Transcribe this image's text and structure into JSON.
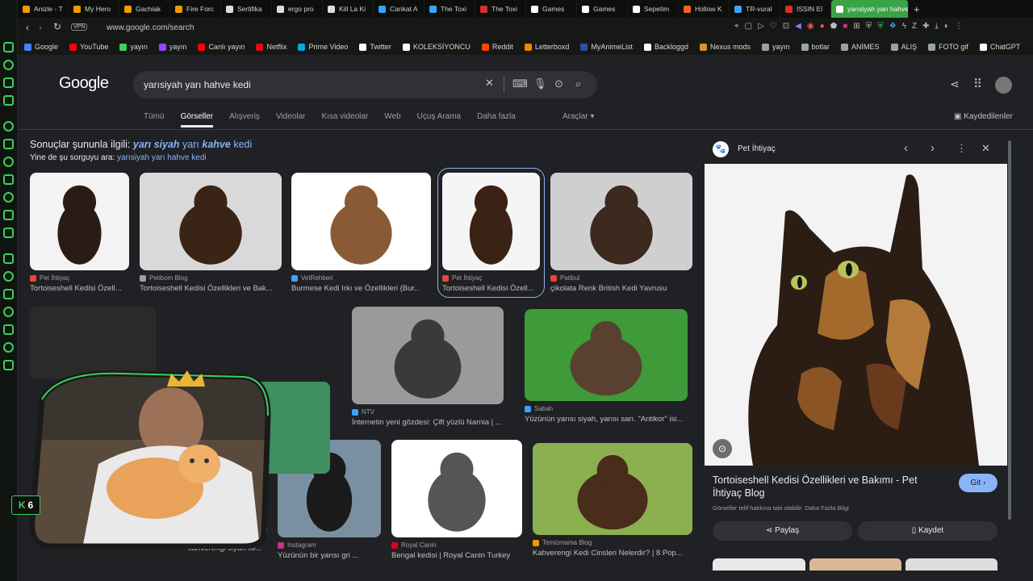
{
  "browser": {
    "tabs": [
      {
        "label": "Anizle - T",
        "color": "#f29900"
      },
      {
        "label": "My Hero",
        "color": "#f29900"
      },
      {
        "label": "Gachiak",
        "color": "#f29900"
      },
      {
        "label": "Fire Forc",
        "color": "#f29900"
      },
      {
        "label": "Sertifika",
        "color": "#dddddd"
      },
      {
        "label": "ergo pro",
        "color": "#dddddd"
      },
      {
        "label": "Kill La Ki",
        "color": "#dddddd"
      },
      {
        "label": "Cankat A",
        "color": "#3aa3ff"
      },
      {
        "label": "The Toxi",
        "color": "#3aa3ff"
      },
      {
        "label": "The Toxi",
        "color": "#d93025"
      },
      {
        "label": "Games",
        "color": "#ffffff"
      },
      {
        "label": "Games",
        "color": "#ffffff"
      },
      {
        "label": "Sepetim",
        "color": "#ffffff"
      },
      {
        "label": "Hollow K",
        "color": "#f26522"
      },
      {
        "label": "TR-vural",
        "color": "#3aa3ff"
      },
      {
        "label": "ISSIN El",
        "color": "#d93025"
      },
      {
        "label": "yarısiyah yarı hahve",
        "color": "#ffffff"
      }
    ],
    "url": "www.google.com/search",
    "vpn_label": "VPN",
    "bookmarks": [
      {
        "label": "Google",
        "color": "#4285f4"
      },
      {
        "label": "YouTube",
        "color": "#ff0000"
      },
      {
        "label": "yayın",
        "color": "#3ad15a"
      },
      {
        "label": "yayın",
        "color": "#9146ff"
      },
      {
        "label": "Canlı yayın",
        "color": "#ff0000"
      },
      {
        "label": "Netflix",
        "color": "#e50914"
      },
      {
        "label": "Prime Video",
        "color": "#00a8e1"
      },
      {
        "label": "Twitter",
        "color": "#ffffff"
      },
      {
        "label": "KOLEKSİYONCU",
        "color": "#ffffff"
      },
      {
        "label": "Reddit",
        "color": "#ff4500"
      },
      {
        "label": "Letterboxd",
        "color": "#ff8000"
      },
      {
        "label": "MyAnimeList",
        "color": "#2e51a2"
      },
      {
        "label": "Backloggd",
        "color": "#ffffff"
      },
      {
        "label": "Nexus mods",
        "color": "#da8e35"
      },
      {
        "label": "yayın",
        "color": "#9aa0a6"
      },
      {
        "label": "botlar",
        "color": "#9aa0a6"
      },
      {
        "label": "ANİMES",
        "color": "#9aa0a6"
      },
      {
        "label": "ALIŞ",
        "color": "#9aa0a6"
      },
      {
        "label": "FOTO gif",
        "color": "#9aa0a6"
      },
      {
        "label": "ChatGPT",
        "color": "#ffffff"
      }
    ]
  },
  "google": {
    "logo": "Google",
    "query": "yarısiyah yarı hahve kedi",
    "nav_tabs": [
      "Tümü",
      "Görseller",
      "Alışveriş",
      "Videolar",
      "Kısa videolar",
      "Web",
      "Uçuş Arama",
      "Daha fazla"
    ],
    "active_tab": "Görseller",
    "tools": "Araçlar",
    "saved": "Kaydedilenler",
    "related_prefix": "Sonuçlar şununla ilgili:",
    "related_w1": "yarı siyah",
    "related_w2": "yarı",
    "related_w3": "kahve",
    "related_w4": "kedi",
    "also_search_prefix": "Yine de şu sorguyu ara:",
    "also_search_link": "yarısiyah yarı hahve kedi"
  },
  "results": [
    {
      "source": "Pet İhtiyaç",
      "title": "Tortoiseshell Kedisi Özell...",
      "color": "#e8453c"
    },
    {
      "source": "Petibom Blog",
      "title": "Tortoiseshell Kedisi Özellikleri ve Bak...",
      "color": "#9aa0a6"
    },
    {
      "source": "VetRehberi",
      "title": "Burmese Kedi Irkı ve Özellikleri (Bur...",
      "color": "#3aa3ff"
    },
    {
      "source": "Pet İhtiyaç",
      "title": "Tortoiseshell Kedisi Özell...",
      "color": "#e8453c"
    },
    {
      "source": "Patibul",
      "title": "çikolata Renk British Kedi Yavrusu",
      "color": "#e8453c"
    },
    {
      "source": "NTV",
      "title": "İnternetin yeni gözdesi: Çift yüzlü Narnia | ...",
      "color": "#3aa3ff"
    },
    {
      "source": "Sabah",
      "title": "Yüzünün yarısı siyah, yarısı sarı. \"Antikor\" isi...",
      "color": "#3aa3ff"
    },
    {
      "source": "",
      "title": "kahverengi siyah ke...",
      "color": "#9aa0a6"
    },
    {
      "source": "Instagram",
      "title": "Yüzünün bir yarısı gri ...",
      "color": "#c13584"
    },
    {
      "source": "Royal Canin",
      "title": "Bengal kedisi | Royal Canin Turkey",
      "color": "#e2001a"
    },
    {
      "source": "Temizmama Blog",
      "title": "Kahverengi Kedi Cinsleri Nelerdir? | 8 Pop...",
      "color": "#f29900"
    }
  ],
  "panel": {
    "source": "Pet İhtiyaç",
    "title": "Tortoiseshell Kedisi Özellikleri ve Bakımı - Pet İhtiyaç Blog",
    "copyright": "Görseller telif hakkına tabi olabilir. Daha Fazla Bilgi",
    "go_label": "Git",
    "share_label": "Paylaş",
    "save_label": "Kaydet"
  },
  "overlay": {
    "score": "6"
  }
}
